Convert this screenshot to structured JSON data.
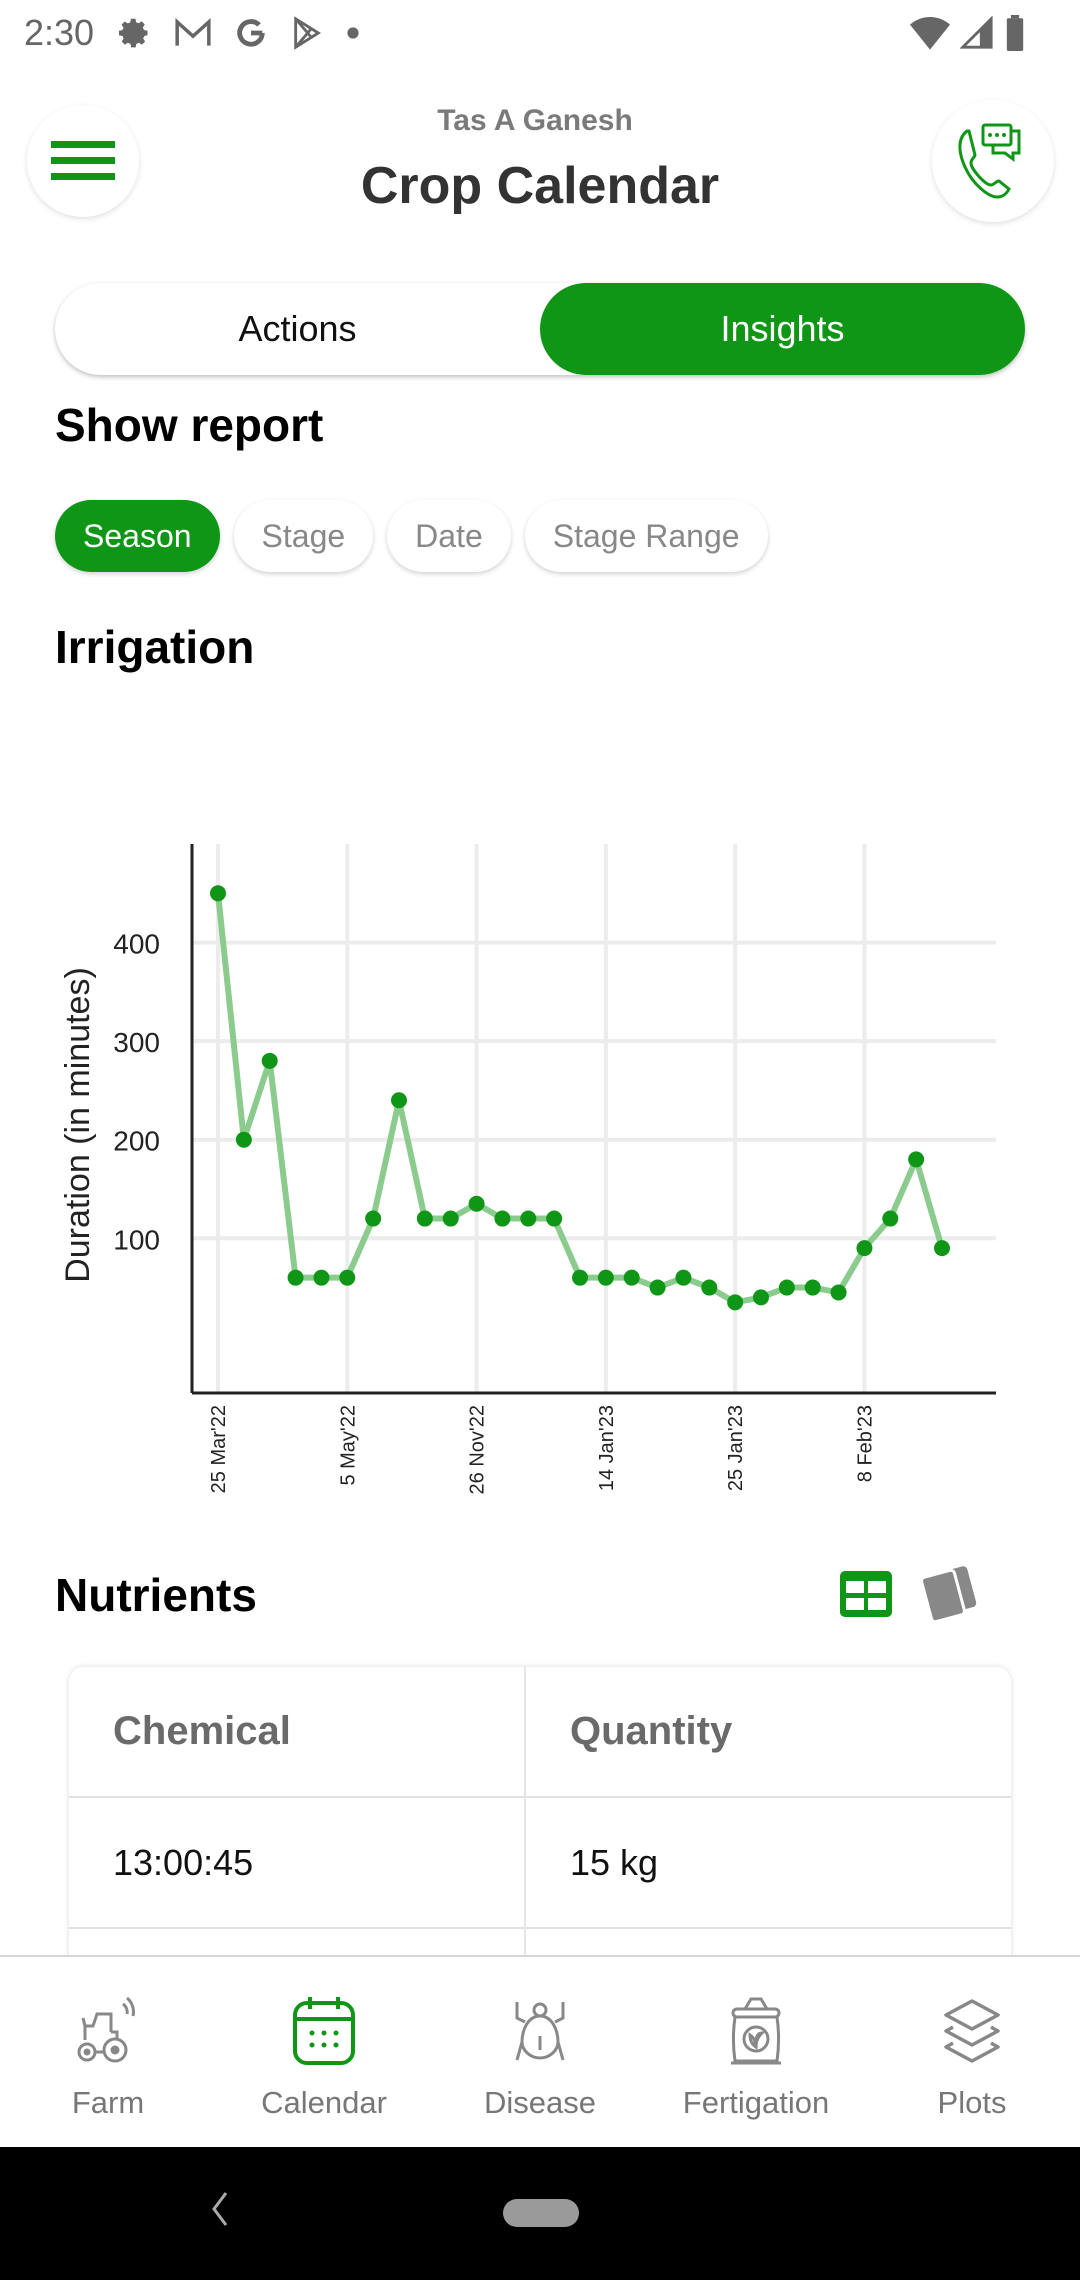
{
  "status_bar": {
    "time": "2:30",
    "icons": [
      "gear-icon",
      "gmail-icon",
      "google-icon",
      "play-store-icon",
      "dot-icon"
    ],
    "right_icons": [
      "wifi-icon",
      "signal-icon",
      "battery-icon"
    ]
  },
  "header": {
    "subtitle": "Tas A  Ganesh",
    "title": "Crop Calendar",
    "menu_icon": "hamburger-menu-icon",
    "call_icon": "phone-chat-icon"
  },
  "segment": {
    "tabs": [
      {
        "label": "Actions",
        "active": false
      },
      {
        "label": "Insights",
        "active": true
      }
    ]
  },
  "report": {
    "title": "Show report",
    "chips": [
      {
        "label": "Season",
        "active": true
      },
      {
        "label": "Stage",
        "active": false
      },
      {
        "label": "Date",
        "active": false
      },
      {
        "label": "Stage Range",
        "active": false
      }
    ]
  },
  "irrigation": {
    "title": "Irrigation"
  },
  "chart_data": {
    "type": "line",
    "title": "Irrigation",
    "xlabel": "",
    "ylabel": "Duration (in minutes)",
    "ylim": [
      -57,
      500
    ],
    "yticks": [
      100,
      200,
      300,
      400
    ],
    "grid": true,
    "legend": "none",
    "x_tick_labels": [
      {
        "index": 0,
        "label": "25 Mar'22"
      },
      {
        "index": 5,
        "label": "5 May'22"
      },
      {
        "index": 10,
        "label": "26 Nov'22"
      },
      {
        "index": 15,
        "label": "14 Jan'23"
      },
      {
        "index": 20,
        "label": "25 Jan'23"
      },
      {
        "index": 25,
        "label": "8 Feb'23"
      }
    ],
    "series": [
      {
        "name": "Duration",
        "color": "#0f9616",
        "line_color": "#8bcc8e",
        "values": [
          450,
          200,
          280,
          60,
          60,
          60,
          120,
          240,
          120,
          120,
          135,
          120,
          120,
          120,
          60,
          60,
          60,
          50,
          60,
          50,
          35,
          40,
          50,
          50,
          45,
          90,
          120,
          180,
          90
        ]
      }
    ]
  },
  "nutrients": {
    "title": "Nutrients",
    "view_icons": [
      "table-view-icon",
      "card-view-icon"
    ],
    "columns": [
      "Chemical",
      "Quantity"
    ],
    "rows": [
      [
        "13:00:45",
        "15 kg"
      ]
    ]
  },
  "bottom_nav": {
    "items": [
      {
        "label": "Farm",
        "icon": "tractor-icon",
        "active": false
      },
      {
        "label": "Calendar",
        "icon": "calendar-icon",
        "active": true
      },
      {
        "label": "Disease",
        "icon": "bug-icon",
        "active": false
      },
      {
        "label": "Fertigation",
        "icon": "fertilizer-bag-icon",
        "active": false
      },
      {
        "label": "Plots",
        "icon": "layers-icon",
        "active": false
      }
    ]
  },
  "colors": {
    "accent": "#0f9616",
    "line": "#8bcc8e",
    "inactive": "#777777"
  }
}
